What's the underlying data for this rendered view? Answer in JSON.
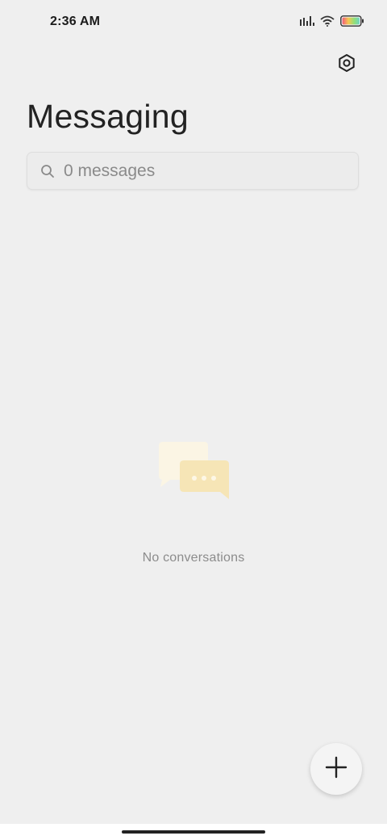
{
  "status_bar": {
    "time": "2:36 AM",
    "icons": [
      "signal-icon",
      "wifi-icon",
      "battery-icon"
    ]
  },
  "header": {
    "title": "Messaging",
    "settings_icon": "settings-hexagon-icon"
  },
  "search": {
    "placeholder": "0 messages",
    "icon": "search-icon"
  },
  "empty_state": {
    "icon": "chat-bubbles-icon",
    "text": "No conversations"
  },
  "fab": {
    "icon": "plus-icon"
  },
  "colors": {
    "background": "#efefef",
    "bubble_light": "#fbf5e4",
    "bubble_accent": "#f6e5b6",
    "text_muted": "#8c8c8c"
  }
}
